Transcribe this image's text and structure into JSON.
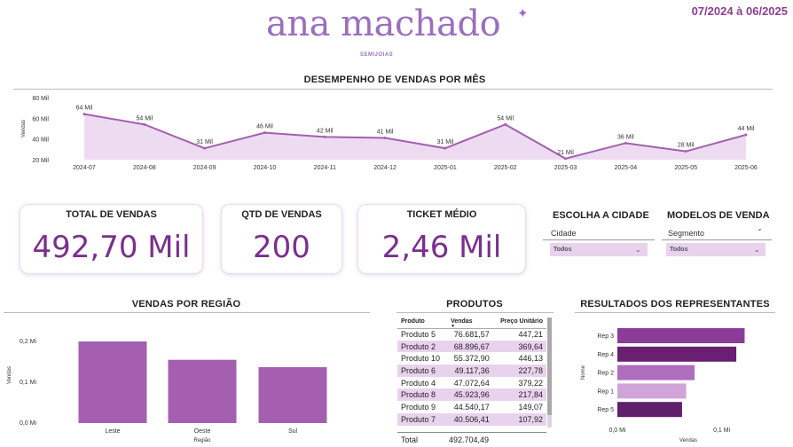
{
  "brand": {
    "name": "ana machado",
    "subtitle": "SEMIJOIAS"
  },
  "period": "07/2024 à 06/2025",
  "line_section": {
    "title": "DESEMPENHO DE VENDAS POR MÊS"
  },
  "kpis": [
    {
      "label": "TOTAL DE VENDAS",
      "value": "492,70 Mil"
    },
    {
      "label": "QTD DE VENDAS",
      "value": "200"
    },
    {
      "label": "TICKET MÉDIO",
      "value": "2,46 Mil"
    }
  ],
  "slicers": {
    "city": {
      "title": "ESCOLHA A CIDADE",
      "field": "Cidade",
      "value": "Todos"
    },
    "segment": {
      "title": "MODELOS DE VENDA",
      "field": "Segmento",
      "value": "Todos"
    }
  },
  "region_section": {
    "title": "VENDAS POR REGIÃO"
  },
  "products": {
    "title": "PRODUTOS",
    "headers": [
      "Produto",
      "Vendas",
      "Preço Unitário"
    ],
    "rows": [
      [
        "Produto 5",
        "76.681,57",
        "447,21"
      ],
      [
        "Produto 2",
        "68.896,67",
        "369,64"
      ],
      [
        "Produto 10",
        "55.372,90",
        "446,13"
      ],
      [
        "Produto 6",
        "49.117,36",
        "227,78"
      ],
      [
        "Produto 4",
        "47.072,64",
        "379,22"
      ],
      [
        "Produto 8",
        "45.923,96",
        "217,84"
      ],
      [
        "Produto 9",
        "44.540,17",
        "149,07"
      ],
      [
        "Produto 7",
        "40.506,41",
        "107,92"
      ]
    ],
    "total_label": "Total",
    "total_value": "492.704,49"
  },
  "reps_section": {
    "title": "RESULTADOS DOS REPRESENTANTES"
  },
  "colors": {
    "accent": "#7b2f8e",
    "brand": "#9b6fc0",
    "bar_region": "#a45fb0",
    "area_fill": "#eddcf1"
  },
  "chart_data": [
    {
      "type": "area",
      "title": "DESEMPENHO DE VENDAS POR MÊS",
      "xlabel": "",
      "ylabel": "Vendas",
      "categories": [
        "2024-07",
        "2024-08",
        "2024-09",
        "2024-10",
        "2024-11",
        "2024-12",
        "2025-01",
        "2025-02",
        "2025-03",
        "2025-04",
        "2025-05",
        "2025-06"
      ],
      "values": [
        64,
        54,
        31,
        46,
        42,
        41,
        31,
        54,
        21,
        36,
        28,
        44
      ],
      "data_labels": [
        "64 Mil",
        "54 Mil",
        "31 Mil",
        "46 Mil",
        "42 Mil",
        "41 Mil",
        "31 Mil",
        "54 Mil",
        "21 Mil",
        "36 Mil",
        "28 Mil",
        "44 Mil"
      ],
      "ylim": [
        20,
        80
      ],
      "yticks": [
        "20 Mil",
        "40 Mil",
        "60 Mil",
        "80 Mil"
      ],
      "ytick_values": [
        20,
        40,
        60,
        80
      ]
    },
    {
      "type": "bar",
      "title": "VENDAS POR REGIÃO",
      "xlabel": "Região",
      "ylabel": "Vendas",
      "categories": [
        "Leste",
        "Oeste",
        "Sul"
      ],
      "values": [
        0.2,
        0.155,
        0.137
      ],
      "ylim": [
        0,
        0.2
      ],
      "yticks": [
        "0,0 Mi",
        "0,1 Mi",
        "0,2 Mi"
      ],
      "ytick_values": [
        0,
        0.1,
        0.2
      ]
    },
    {
      "type": "bar",
      "orientation": "horizontal",
      "title": "RESULTADOS DOS REPRESENTANTES",
      "xlabel": "Vendas",
      "ylabel": "Nome",
      "categories": [
        "Rep 3",
        "Rep 4",
        "Rep 2",
        "Rep 1",
        "Rep 5"
      ],
      "values": [
        0.122,
        0.114,
        0.074,
        0.066,
        0.062
      ],
      "colors": [
        "#8b3c99",
        "#6a1f73",
        "#b06cbd",
        "#d0a4d8",
        "#5f1f6a"
      ],
      "xticks": [
        "0,0 Mi",
        "0,1 Mi"
      ],
      "xtick_values": [
        0,
        0.1
      ],
      "xlim": [
        0,
        0.125
      ]
    }
  ]
}
